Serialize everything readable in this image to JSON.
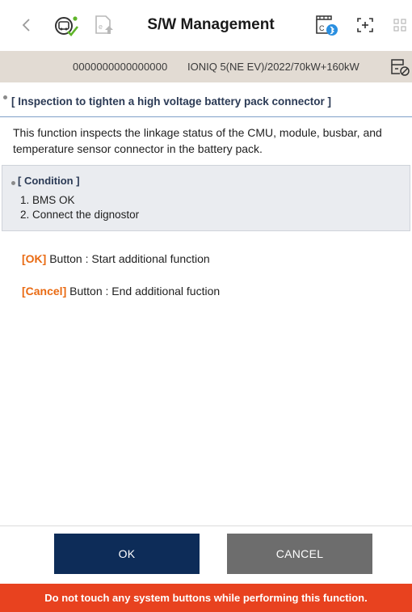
{
  "header": {
    "title": "S/W Management",
    "icons": [
      "back-icon",
      "vehicle-scan-icon",
      "document-upload-icon",
      "vci-bluetooth-icon",
      "screenshot-icon",
      "grid-menu-icon"
    ]
  },
  "vehicle": {
    "vin": "0000000000000000",
    "info": "IONIQ 5(NE EV)/2022/70kW+160kW",
    "icon": "vehicle-status-icon"
  },
  "section": {
    "title": "[ Inspection to tighten a high voltage battery pack connector ]",
    "description": "This function inspects the linkage status of the CMU, module, busbar, and temperature sensor connector in the battery pack."
  },
  "condition": {
    "heading": "[ Condition ]",
    "items": [
      "1. BMS OK",
      "2. Connect the dignostor"
    ]
  },
  "hints": [
    {
      "key": "[OK]",
      "text": " Button : Start additional function"
    },
    {
      "key": "[Cancel]",
      "text": " Button : End additional fuction"
    }
  ],
  "buttons": {
    "ok": "OK",
    "cancel": "CANCEL"
  },
  "warning": "Do not touch any system buttons while performing this function.",
  "colors": {
    "vehicle_bar": "#e2dbd3",
    "ok_button": "#0d2c58",
    "cancel_button": "#6d6d6d",
    "warning_bar": "#e8421f",
    "hint_key": "#e96a12"
  }
}
